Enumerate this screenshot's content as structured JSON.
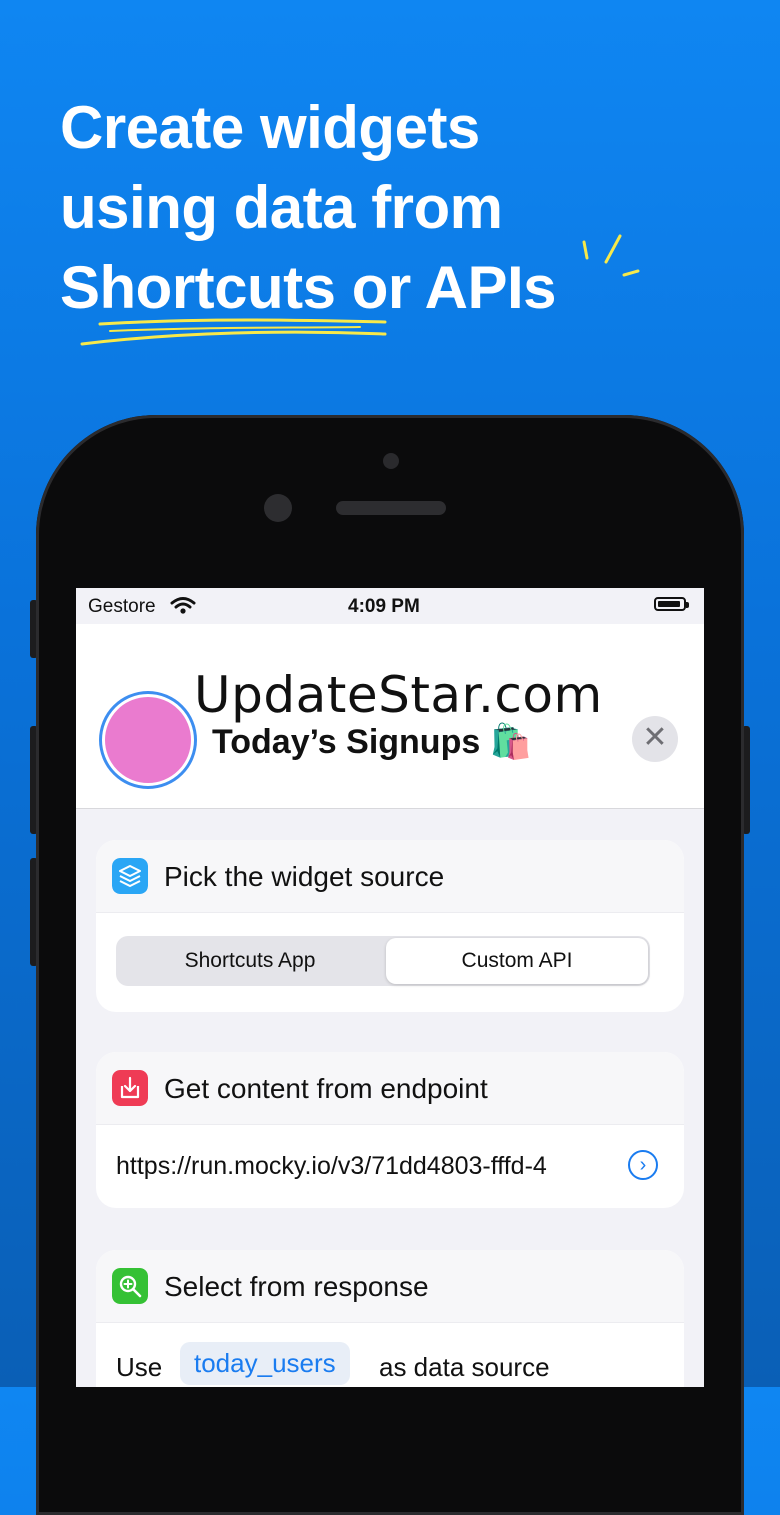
{
  "colors": {
    "background": "#0f86f2",
    "accent": "#1a7cf0",
    "avatar": "#ea7bcf",
    "scribble": "#f7e94a",
    "source_icon": "#2aa6f5",
    "endpoint_icon": "#ef3b55",
    "response_icon": "#35c135"
  },
  "headline": {
    "line1": "Create widgets",
    "line2": "using data from",
    "line3": "Shortcuts or APIs"
  },
  "status_bar": {
    "carrier": "Gestore",
    "time": "4:09 PM",
    "battery_level": 0.9
  },
  "header": {
    "watermark": "UpdateStar.com",
    "title": "Today’s Signups 🛍️",
    "close_symbol": "✕"
  },
  "source_card": {
    "icon": "stack-layers-icon",
    "title": "Pick the widget source",
    "options": [
      "Shortcuts App",
      "Custom API"
    ],
    "selected": "Custom API"
  },
  "endpoint_card": {
    "icon": "download-tray-icon",
    "title": "Get content from endpoint",
    "url": "https://run.mocky.io/v3/71dd4803-fffd-4",
    "go_symbol": "›"
  },
  "response_card": {
    "icon": "magnifier-plus-icon",
    "title": "Select from response",
    "prefix": "Use",
    "key": "today_users",
    "suffix": "as data source"
  }
}
